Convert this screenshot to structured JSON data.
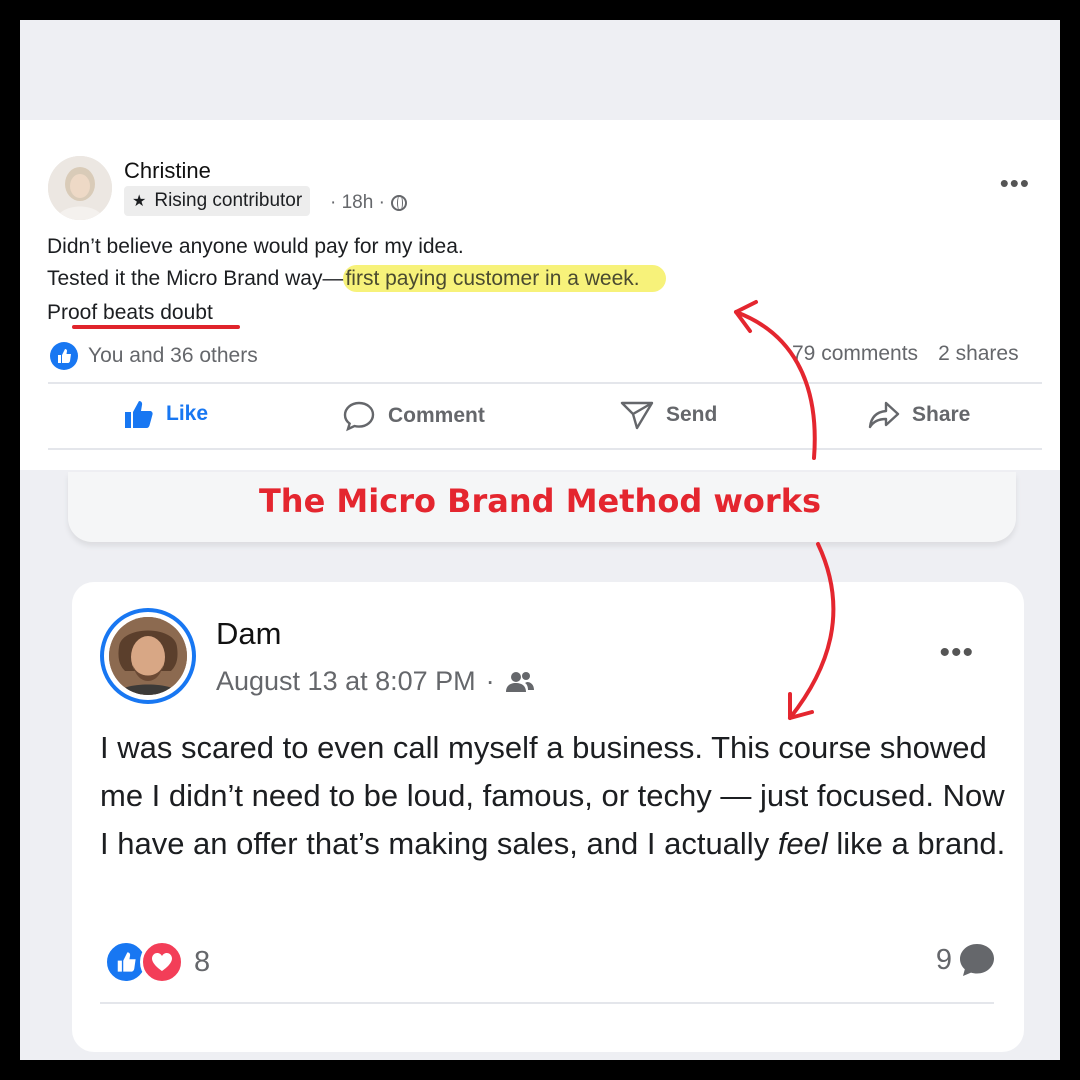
{
  "post1": {
    "author": "Christine",
    "badge": "Rising contributor",
    "time": "· 18h ·",
    "line1": "Didn’t believe anyone would pay for my idea.",
    "line2_start": "Tested it the Micro Brand way—",
    "line2_highlight": "first paying customer in a week.",
    "line3": "Proof beats doubt",
    "reactions": "You and 36 others",
    "comments": "79 comments",
    "shares": "2 shares",
    "actions": {
      "like": "Like",
      "comment": "Comment",
      "send": "Send",
      "share": "Share"
    }
  },
  "caption": "The Micro Brand Method works",
  "post2": {
    "author": "Dam",
    "timestamp": "August 13 at 8:07 PM",
    "separator": "·",
    "text_start": "I was scared to even call myself a business. This course showed me I didn’t need to be loud, famous, or techy — just focused. Now I have an offer that’s making sales, and I actually ",
    "text_emph": "feel",
    "text_end": " like a brand.",
    "reaction_count": "8",
    "comment_count": "9"
  },
  "colors": {
    "accent": "#e4262f",
    "facebook_blue": "#1877f2",
    "highlight": "#f7f27a",
    "love": "#f33e58"
  }
}
